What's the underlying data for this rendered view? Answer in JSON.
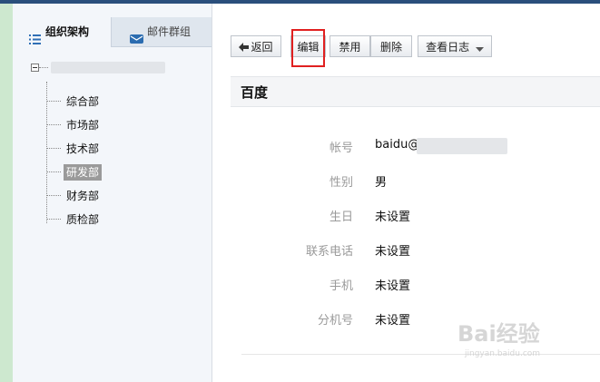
{
  "sidebar": {
    "tabs": [
      {
        "label": "组织架构",
        "icon": "list-icon",
        "active": true
      },
      {
        "label": "邮件群组",
        "icon": "mail-group-icon",
        "active": false
      }
    ],
    "tree": {
      "root_label": "",
      "children": [
        "综合部",
        "市场部",
        "技术部",
        "研发部",
        "财务部",
        "质检部"
      ],
      "selected": "研发部"
    }
  },
  "toolbar": {
    "back_label": "返回",
    "edit_label": "编辑",
    "disable_label": "禁用",
    "delete_label": "删除",
    "log_label": "查看日志"
  },
  "profile": {
    "name": "百度",
    "fields": [
      {
        "label": "帐号",
        "value": "baidu@"
      },
      {
        "label": "性别",
        "value": "男"
      },
      {
        "label": "生日",
        "value": "未设置"
      },
      {
        "label": "联系电话",
        "value": "未设置"
      },
      {
        "label": "手机",
        "value": "未设置"
      },
      {
        "label": "分机号",
        "value": "未设置"
      }
    ]
  },
  "watermark": {
    "brand": "Bai经验",
    "url": "jingyan.baidu.com"
  },
  "colors": {
    "highlight": "#e02020",
    "selected_bg": "#9a9a9a",
    "topbar": "#2a4f7c"
  }
}
